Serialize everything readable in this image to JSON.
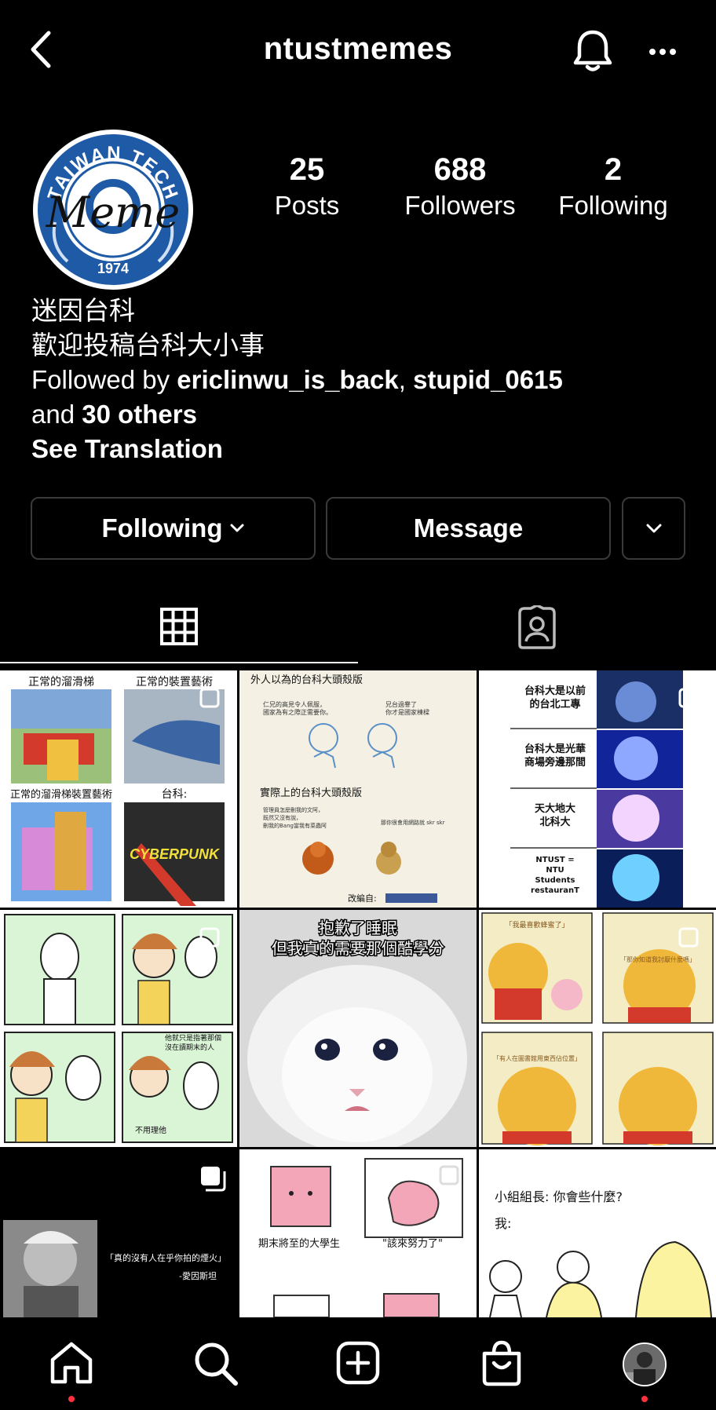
{
  "header": {
    "username": "ntustmemes"
  },
  "profile": {
    "avatar": {
      "ring_text": "TAIWAN TECH",
      "scribble": "Meme",
      "year": "1974"
    },
    "stats": [
      {
        "value": "25",
        "label": "Posts"
      },
      {
        "value": "688",
        "label": "Followers"
      },
      {
        "value": "2",
        "label": "Following"
      }
    ],
    "name": "迷因台科",
    "bio": "歡迎投稿台科大小事",
    "followed_by": {
      "prefix": "Followed by ",
      "user1": "ericlinwu_is_back",
      "sep": ", ",
      "user2": "stupid_0615",
      "and": "and ",
      "others": "30 others"
    },
    "see_translation": "See Translation"
  },
  "actions": {
    "following_label": "Following",
    "message_label": "Message"
  },
  "posts": {
    "p1": {
      "t1": "正常的溜滑梯",
      "t2": "正常的裝置藝術",
      "t3": "正常的溜滑梯裝置藝術",
      "t4": "台科:",
      "t5": "CYBERPUNK"
    },
    "p2": {
      "t1": "外人以為的台科大頭殼版",
      "t2": "仁兄的高見令人佩服，",
      "t3": "國家為有之際正需要你。",
      "t4": "兄台過譽了",
      "t5": "你才是國家棟樑",
      "t6": "實際上的台科大頭殼版",
      "t7": "管理員怎麼刪我的文阿，",
      "t8": "既然又沒有說，",
      "t9": "刪我的Bang當我有菜蟲阿",
      "t10": "那你很會用網路就 skr skr",
      "t11": "改編自:"
    },
    "p3": {
      "t1": "台科大是以前",
      "t2": "的台北工專",
      "t3": "台科大是光華",
      "t4": "商場旁邊那間",
      "t5": "天大地大",
      "t6": "北科大",
      "t7": "NTUST =",
      "t8": "NTU",
      "t9": "Students",
      "t10": "restauranT"
    },
    "p4": {
      "t1": "他就只是指著那個",
      "t2": "沒在讀期末的人",
      "t3": "不用理他"
    },
    "p5": {
      "t1": "抱歉了睡眠",
      "t2": "但我真的需要那個酷學分"
    },
    "p6": {
      "t1": "「我最喜歡蜂蜜了」",
      "t2": "「那你知道我討厭什麼嗎」",
      "t3": "「有人在圖書館用東西佔位置」"
    },
    "p7": {
      "t1": "「真的沒有人在乎你拍的煙火」",
      "t2": "-愛因斯坦"
    },
    "p8": {
      "t1": "期末將至的大學生",
      "t2": "\"該來努力了\""
    },
    "p9": {
      "t1": "小組組長: 你會些什麼?",
      "t2": "我:"
    }
  },
  "colors": {
    "notification_dot": "#ff3040",
    "avatar_blue": "#1f5aa6"
  },
  "icons": [
    "back-icon",
    "bell-icon",
    "more-icon",
    "chevron-down-icon",
    "grid-icon",
    "tagged-icon",
    "home-icon",
    "search-icon",
    "add-post-icon",
    "shop-icon",
    "profile-avatar"
  ]
}
